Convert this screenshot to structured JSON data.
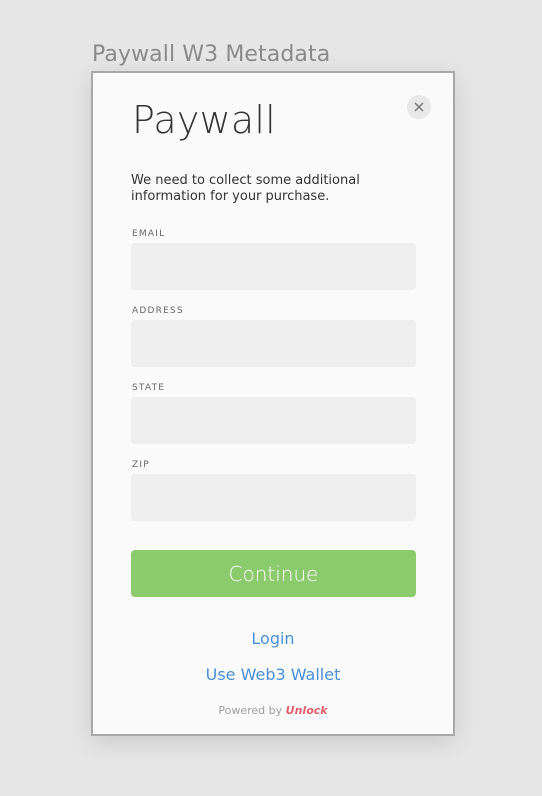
{
  "frame": {
    "title": "Paywall W3 Metadata"
  },
  "modal": {
    "heading": "Paywall",
    "intro": "We need to collect some additional information for your purchase.",
    "close_icon": "close-icon"
  },
  "form": {
    "fields": [
      {
        "label": "EMAIL",
        "value": "",
        "placeholder": ""
      },
      {
        "label": "ADDRESS",
        "value": "",
        "placeholder": ""
      },
      {
        "label": "STATE",
        "value": "",
        "placeholder": ""
      },
      {
        "label": "ZIP",
        "value": "",
        "placeholder": ""
      }
    ],
    "continue_label": "Continue"
  },
  "links": {
    "login": "Login",
    "web3_wallet": "Use Web3 Wallet"
  },
  "footer": {
    "powered_by": "Powered by",
    "brand": "Unlock"
  },
  "colors": {
    "primary_button": "#8ccb6d",
    "link": "#4a90d9",
    "brand": "#e35d6a"
  }
}
